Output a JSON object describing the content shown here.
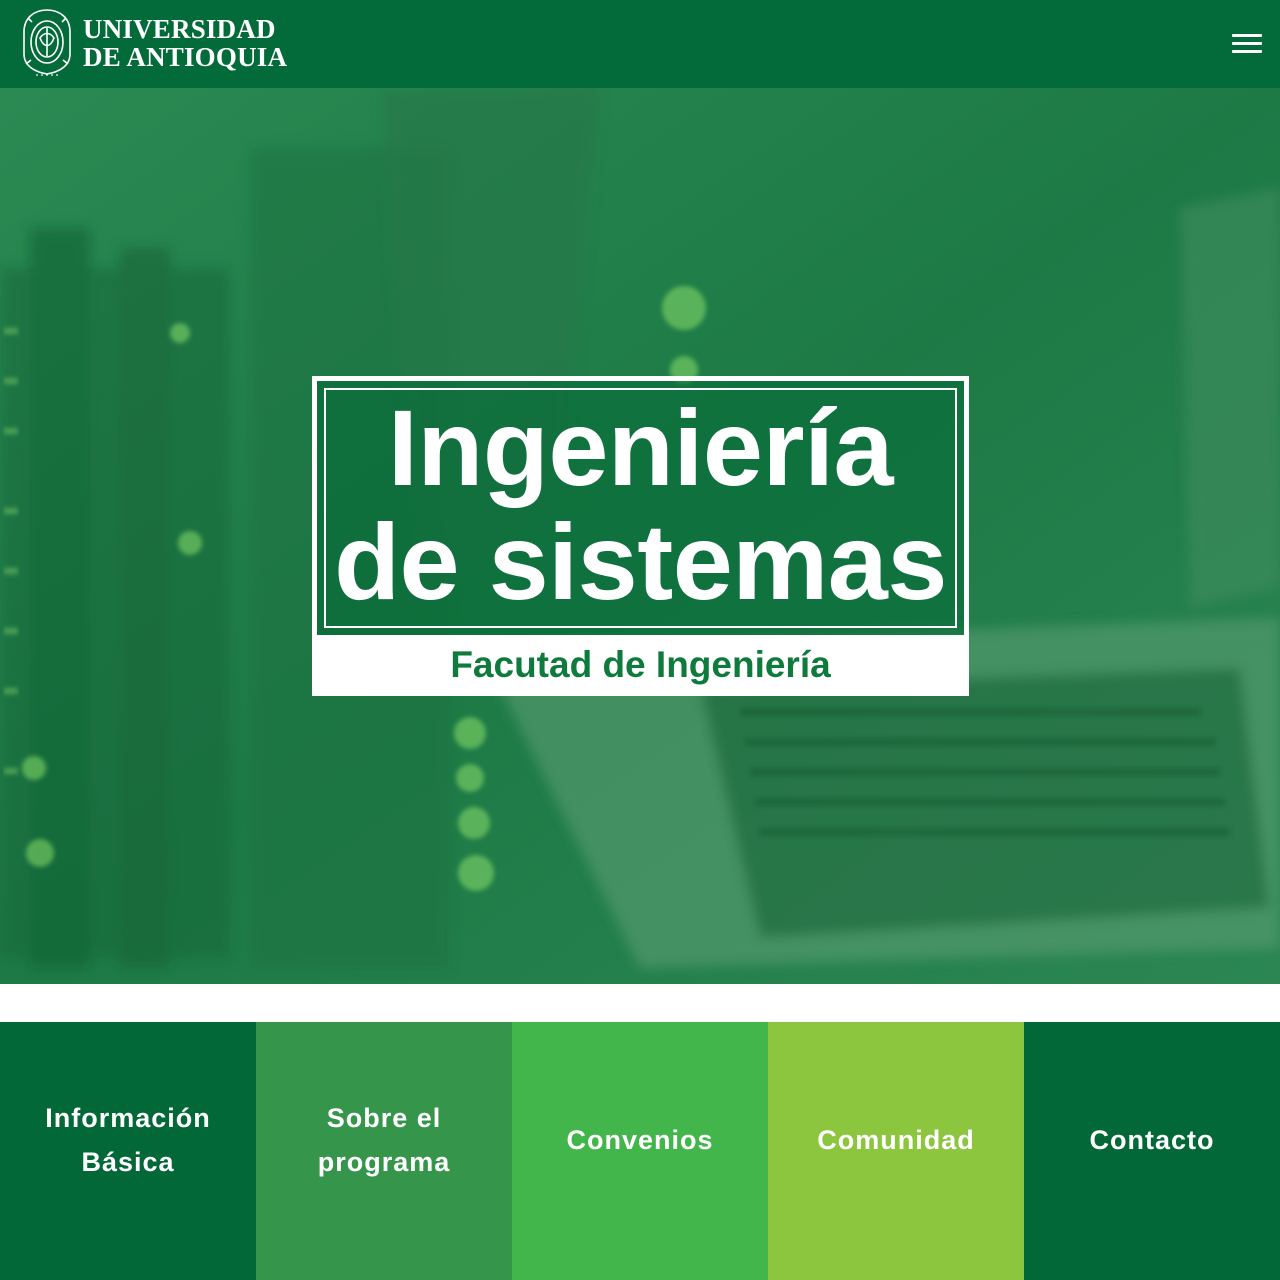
{
  "header": {
    "logo_line1": "UNIVERSIDAD",
    "logo_line2": "DE ANTIOQUIA",
    "seal_icon": "university-seal-icon",
    "menu_icon": "hamburger-menu-icon",
    "background_color": "#026b39"
  },
  "hero": {
    "title": "Ingeniería de sistemas",
    "subtitle": "Facutad de Ingeniería",
    "overlay_color": "#0b7a40"
  },
  "nav_tiles": [
    {
      "label": "Información Básica",
      "color": "#036837"
    },
    {
      "label": "Sobre el programa",
      "color": "#35954b"
    },
    {
      "label": "Convenios",
      "color": "#42b64a"
    },
    {
      "label": "Comunidad",
      "color": "#8cc63f"
    },
    {
      "label": "Contacto",
      "color": "#036837"
    }
  ]
}
